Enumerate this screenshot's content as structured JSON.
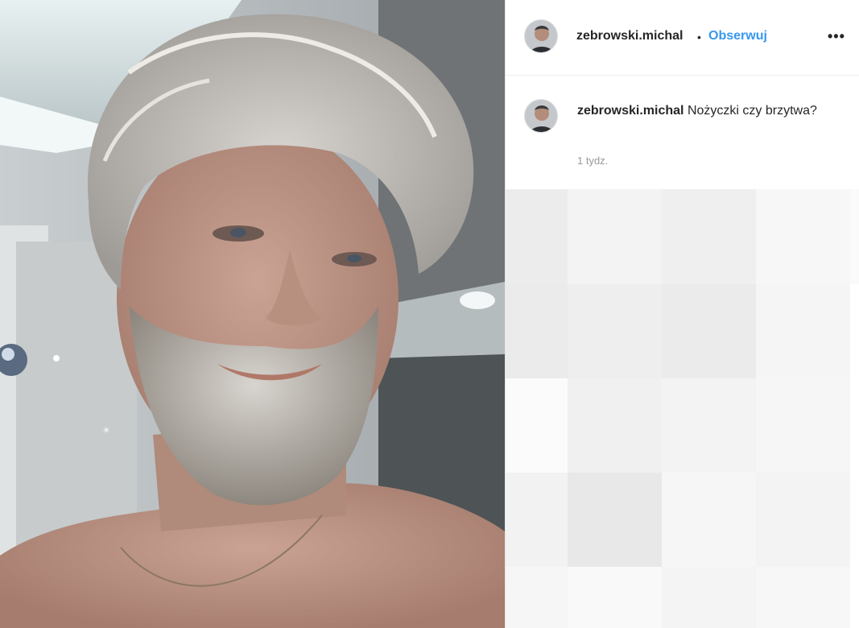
{
  "header": {
    "username": "zebrowski.michal",
    "separator": "•",
    "follow_label": "Obserwuj",
    "more_label": "•••"
  },
  "caption": {
    "username": "zebrowski.michal",
    "text": "Nożyczki czy brzytwa?",
    "timestamp": "1 tydz."
  },
  "colors": {
    "link": "#3897f0",
    "text": "#262626",
    "muted": "#999999"
  }
}
